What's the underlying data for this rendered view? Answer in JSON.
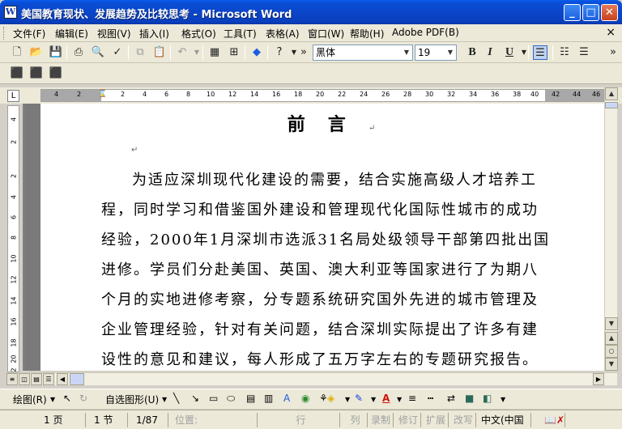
{
  "window": {
    "title": "美国教育现状、发展趋势及比较思考 - Microsoft Word",
    "app_icon": "W",
    "minimize": "_",
    "maximize": "□",
    "close": "✕"
  },
  "menu": {
    "items": [
      "文件(F)",
      "编辑(E)",
      "视图(V)",
      "插入(I)",
      "格式(O)",
      "工具(T)",
      "表格(A)",
      "窗口(W)",
      "帮助(H)",
      "Adobe PDF(B)"
    ],
    "close_doc": "×"
  },
  "toolbar": {
    "font_name": "黑体",
    "font_size": "19",
    "bold": "B",
    "italic": "I",
    "underline": "U",
    "overflow": "»"
  },
  "ruler": {
    "ticks": [
      "4",
      "2",
      "2",
      "4",
      "6",
      "8",
      "10",
      "12",
      "14",
      "16",
      "18",
      "20",
      "22",
      "24",
      "26",
      "28",
      "30",
      "32",
      "34",
      "36",
      "38",
      "40",
      "42",
      "44",
      "46"
    ],
    "corner": "L",
    "vticks": [
      "4",
      "2",
      "2",
      "4",
      "6",
      "8",
      "10",
      "12",
      "14",
      "16",
      "18",
      "20",
      "22"
    ]
  },
  "document": {
    "heading": "前言",
    "paragraph_mark": "↵",
    "lines": [
      "为适应深圳现代化建设的需要，结合实施高级人才培养工",
      "程，同时学习和借鉴国外建设和管理现代化国际性城市的成功",
      "经验，2000年1月深圳市选派31名局处级领导干部第四批出国",
      "进修。学员们分赴美国、英国、澳大利亚等国家进行了为期八",
      "个月的实地进修考察，分专题系统研究国外先进的城市管理及",
      "企业管理经验，针对有关问题，结合深圳实际提出了许多有建",
      "设性的意见和建议，每人形成了五万字左右的专题研究报告。"
    ]
  },
  "drawbar": {
    "draw": "绘图(R)",
    "autoshapes": "自选图形(U)"
  },
  "status": {
    "page": "1 页",
    "section": "1 节",
    "pages": "1/87",
    "position": "位置:",
    "line": "行",
    "column": "列",
    "rec": "录制",
    "trk": "修订",
    "ext": "扩展",
    "ovr": "改写",
    "lang": "中文(中国"
  }
}
